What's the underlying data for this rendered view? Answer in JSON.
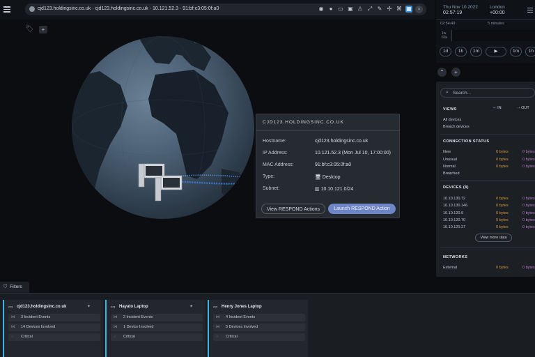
{
  "browser": {
    "url": "cjd123.holdingsinc.co.uk · cjd123.holdingsinc.co.uk · 10.121.52.3 · 91:bf:c3:05:0f:a0",
    "tool_icons": [
      "fingerprint-icon",
      "pin-icon",
      "chat-icon",
      "image-icon",
      "warning-icon",
      "expand-icon",
      "edit-icon",
      "network-icon",
      "graph-icon",
      "compass-icon"
    ],
    "close_glyph": "×"
  },
  "popup": {
    "title": "CJD123.HOLDINGSINC.CO.UK",
    "rows": [
      {
        "label": "Hostname:",
        "value": "cjd123.holdingsinc.co.uk"
      },
      {
        "label": "IP Address:",
        "value": "10.121.52.3 (Mon Jul 10, 17:00:00)"
      },
      {
        "label": "MAC Address:",
        "value": "91:bf:c3:05:0f:a0"
      },
      {
        "label": "Type:",
        "value": "Desktop"
      },
      {
        "label": "Subnet:",
        "value": "10.10.121.0/24"
      }
    ],
    "view_button": "View RESPOND Actions",
    "launch_button": "Launch RESPOND Action"
  },
  "clock": {
    "date": "Thu Nov 10 2022",
    "time": "02:57:19",
    "city": "London",
    "utc": "+00:00"
  },
  "timeline": {
    "start_time": "02:54:49",
    "range": "5 minutes",
    "axis_label": "1w 60s",
    "controls": [
      "1d",
      "1h",
      "1m",
      "▶",
      "1m",
      "1h"
    ]
  },
  "sidebar": {
    "search_placeholder": "Search...",
    "views": {
      "title": "VIEWS",
      "in_label": "IN",
      "out_label": "OUT",
      "items": [
        "All devices",
        "Breach devices"
      ]
    },
    "connection_status": {
      "title": "CONNECTION STATUS",
      "rows": [
        {
          "label": "New",
          "in": "0 bytes",
          "out": "0 bytes"
        },
        {
          "label": "Unusual",
          "in": "0 bytes",
          "out": "0 bytes"
        },
        {
          "label": "Normal",
          "in": "0 bytes",
          "out": "0 bytes"
        },
        {
          "label": "Breached",
          "in": "",
          "out": ""
        }
      ]
    },
    "devices": {
      "title": "DEVICES (8)",
      "rows": [
        {
          "label": "10.10.130.72",
          "in": "0 bytes",
          "out": "0 bytes"
        },
        {
          "label": "10.10.130.146",
          "in": "0 bytes",
          "out": "0 bytes"
        },
        {
          "label": "10.10.120.9",
          "in": "0 bytes",
          "out": "0 bytes"
        },
        {
          "label": "10.10.120.70",
          "in": "0 bytes",
          "out": "0 bytes"
        },
        {
          "label": "10.10.120.27",
          "in": "0 bytes",
          "out": "0 bytes"
        }
      ],
      "view_more": "View more data"
    },
    "networks": {
      "title": "NETWORKS",
      "rows": [
        {
          "label": "External",
          "in": "0 bytes",
          "out": "0 bytes"
        }
      ]
    }
  },
  "filters_label": "Filters",
  "cards": [
    {
      "title": "cjd123.holdingsinc.co.uk",
      "incidents": "3 Incident Events",
      "devices": "14 Devices Involved",
      "severity": "Critical",
      "pinned": true
    },
    {
      "title": "Hayato Laptop",
      "incidents": "2 Incident Events",
      "devices": "1 Device Involved",
      "severity": "Critical",
      "pinned": true
    },
    {
      "title": "Henry Jones Laptop",
      "incidents": "4 Incident Events",
      "devices": "5 Devices Involved",
      "severity": "Critical",
      "pinned": false
    }
  ],
  "colors": {
    "accent": "#6e85c6",
    "incoming": "#d29a3a",
    "outgoing": "#b679c9",
    "card_accent": "#3ab5e6"
  }
}
